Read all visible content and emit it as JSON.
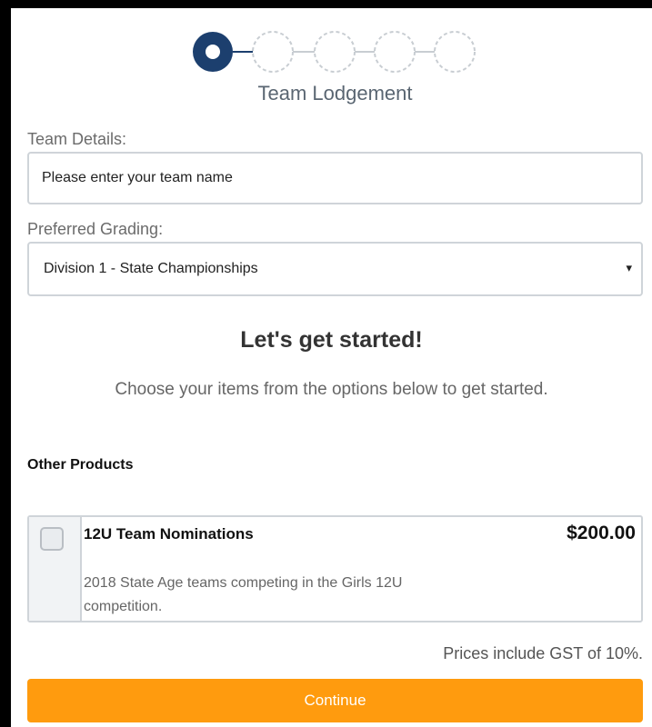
{
  "wizard": {
    "step_title": "Team Lodgement",
    "current_step": 1,
    "total_steps": 5
  },
  "form": {
    "team_label": "Team Details:",
    "team_placeholder": "Please enter your team name",
    "grading_label": "Preferred Grading:",
    "grading_value": "Division 1 - State Championships",
    "grading_arrow": "▾"
  },
  "intro": {
    "heading": "Let's get started!",
    "subheading": "Choose your items from the options below to get started."
  },
  "products": {
    "section_title": "Other Products",
    "items": [
      {
        "name": "12U Team Nominations",
        "price": "$200.00",
        "description": "2018 State Age teams competing in the Girls 12U competition.",
        "checked": false
      }
    ]
  },
  "footer": {
    "gst_note": "Prices include GST of 10%.",
    "continue_label": "Continue"
  },
  "colors": {
    "step_active": "#1c3f6e",
    "step_inactive": "#c8cdd2",
    "accent_button": "#ff9b0e"
  }
}
